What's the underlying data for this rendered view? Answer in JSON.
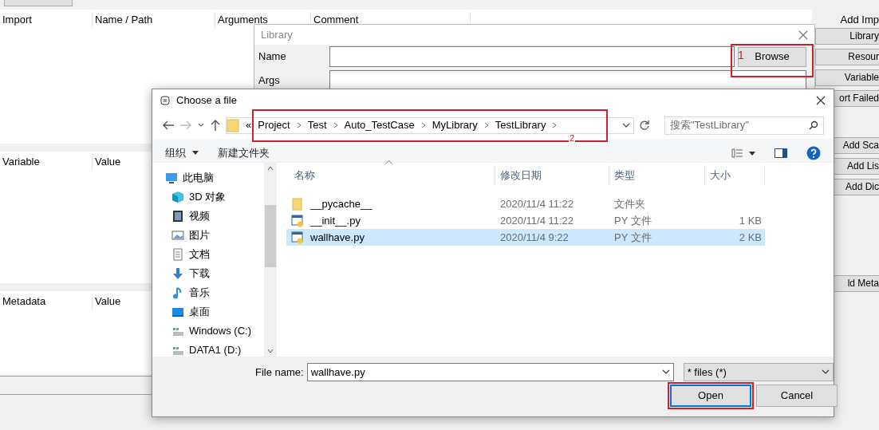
{
  "app": {
    "import_table": {
      "columns": [
        "Import",
        "Name / Path",
        "Arguments",
        "Comment"
      ]
    },
    "variable_table": {
      "columns": [
        "Variable",
        "Value"
      ]
    },
    "metadata_table": {
      "columns": [
        "Metadata",
        "Value"
      ]
    },
    "side_groups": [
      {
        "heading": "Add Imp",
        "buttons": [
          "Library",
          "Resour",
          "Variable",
          "ort Failed"
        ]
      },
      {
        "buttons": [
          "Add Sca",
          "Add Lis",
          "Add Dic"
        ]
      },
      {
        "buttons": [
          "ld Meta"
        ]
      }
    ]
  },
  "library_dialog": {
    "title": "Library",
    "fields": [
      {
        "label": "Name"
      },
      {
        "label": "Args"
      }
    ],
    "browse": {
      "label": "Browse",
      "annotation": "1"
    }
  },
  "file_dialog": {
    "title": "Choose a file",
    "address": {
      "overflow": "«",
      "crumbs": [
        "Project",
        "Test",
        "Auto_TestCase",
        "MyLibrary",
        "TestLibrary"
      ],
      "annotation": "2"
    },
    "search": {
      "placeholder": "搜索\"TestLibrary\""
    },
    "toolbar": [
      {
        "label": "组织",
        "dropdown": true
      },
      {
        "label": "新建文件夹",
        "dropdown": false
      }
    ],
    "nav_items": [
      {
        "label": "此电脑",
        "kind": "pc"
      },
      {
        "label": "3D 对象",
        "kind": "cube"
      },
      {
        "label": "视频",
        "kind": "video"
      },
      {
        "label": "图片",
        "kind": "picture"
      },
      {
        "label": "文档",
        "kind": "document"
      },
      {
        "label": "下载",
        "kind": "download"
      },
      {
        "label": "音乐",
        "kind": "music"
      },
      {
        "label": "桌面",
        "kind": "desktop"
      },
      {
        "label": "Windows (C:)",
        "kind": "drive"
      },
      {
        "label": "DATA1 (D:)",
        "kind": "drive"
      }
    ],
    "columns": [
      "名称",
      "修改日期",
      "类型",
      "大小"
    ],
    "files": [
      {
        "name": "__pycache__",
        "kind": "folder",
        "modified": "2020/11/4 11:22",
        "type": "文件夹",
        "selected": false
      },
      {
        "name": "__init__.py",
        "kind": "py",
        "modified": "2020/11/4 11:22",
        "type": "PY 文件",
        "size": "1 KB",
        "selected": false
      },
      {
        "name": "wallhave.py",
        "kind": "py",
        "modified": "2020/11/4 9:22",
        "type": "PY 文件",
        "size": "2 KB",
        "selected": true
      }
    ],
    "file_name": {
      "label": "File name:",
      "value": "wallhave.py"
    },
    "filter": "* files (*)",
    "buttons": [
      {
        "label": "Open",
        "focused": true,
        "highlighted": true
      },
      {
        "label": "Cancel",
        "focused": false,
        "highlighted": false
      }
    ]
  }
}
